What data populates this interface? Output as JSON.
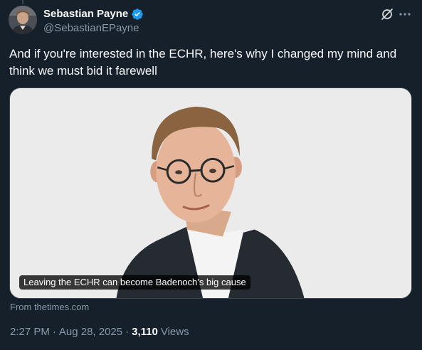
{
  "author": {
    "display_name": "Sebastian Payne",
    "handle": "@SebastianEPayne",
    "verified": true
  },
  "icons": {
    "verified": "verified-badge-icon",
    "grok": "grok-icon",
    "more": "more-options-icon"
  },
  "tweet": {
    "text": "And if you're interested in the ECHR, here's why I changed my mind and think we must bid it farewell"
  },
  "card": {
    "title": "Leaving the ECHR can become Badenoch’s big cause",
    "source": "From thetimes.com"
  },
  "meta": {
    "time": "2:27 PM",
    "sep1": "·",
    "date": "Aug 28, 2025",
    "sep2": "·",
    "views_count": "3,110",
    "views_label": "Views"
  },
  "colors": {
    "background": "#15202b",
    "text_primary": "#f7f9f9",
    "text_secondary": "#8b98a5",
    "verified_blue": "#1d9bf0",
    "border": "#38444d"
  }
}
